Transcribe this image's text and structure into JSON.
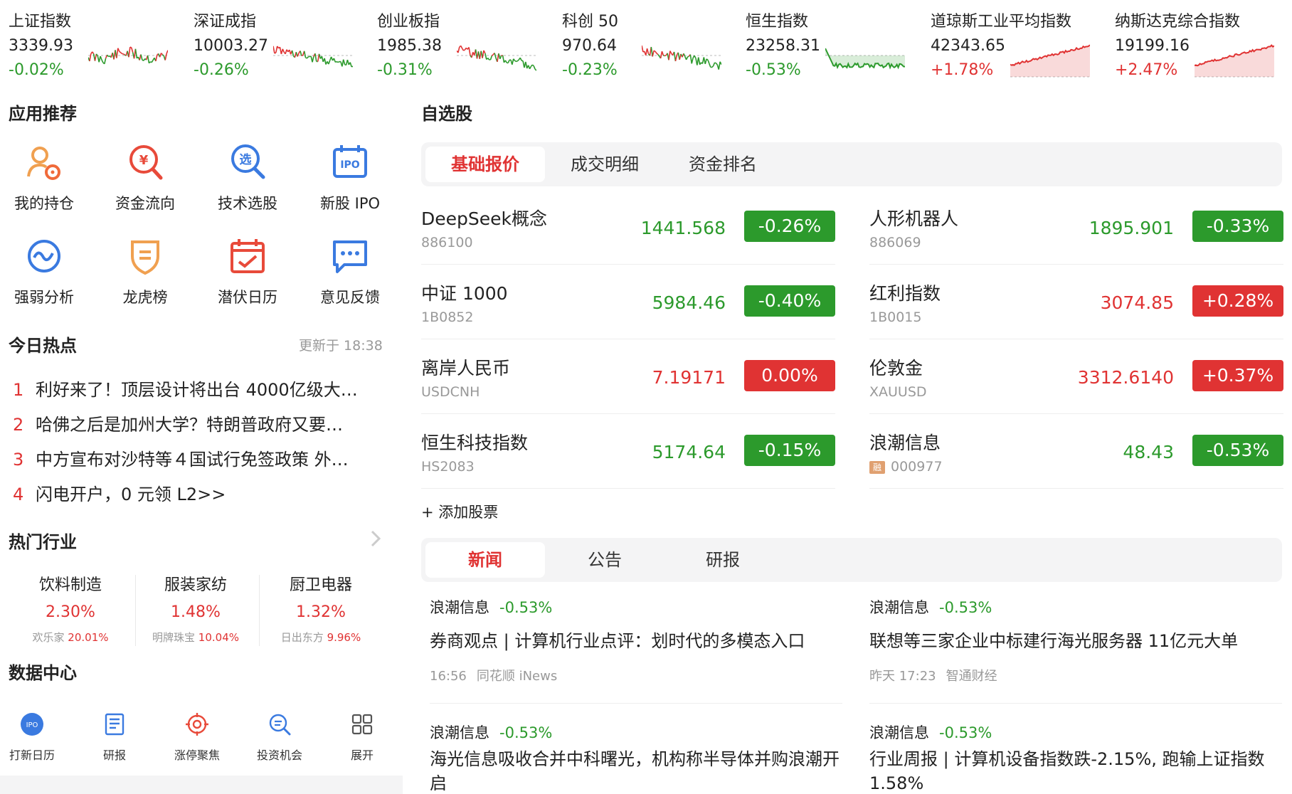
{
  "indices": [
    {
      "name": "上证指数",
      "price": "3339.93",
      "pct": "-0.02%",
      "dir": "down",
      "chart": "mixed"
    },
    {
      "name": "深证成指",
      "price": "10003.27",
      "pct": "-0.26%",
      "dir": "down",
      "chart": "mixed-down"
    },
    {
      "name": "创业板指",
      "price": "1985.38",
      "pct": "-0.31%",
      "dir": "down",
      "chart": "mixed-down"
    },
    {
      "name": "科创 50",
      "price": "970.64",
      "pct": "-0.23%",
      "dir": "down",
      "chart": "mixed-down"
    },
    {
      "name": "恒生指数",
      "price": "23258.31",
      "pct": "-0.53%",
      "dir": "down",
      "chart": "down-area"
    },
    {
      "name": "道琼斯工业平均指数",
      "price": "42343.65",
      "pct": "+1.78%",
      "dir": "up",
      "chart": "up-area"
    },
    {
      "name": "纳斯达克综合指数",
      "price": "19199.16",
      "pct": "+2.47%",
      "dir": "up",
      "chart": "up-area"
    }
  ],
  "apps": {
    "title": "应用推荐",
    "items": [
      {
        "label": "我的持仓",
        "icon": "holdings-icon"
      },
      {
        "label": "资金流向",
        "icon": "money-flow-icon"
      },
      {
        "label": "技术选股",
        "icon": "stock-picker-icon"
      },
      {
        "label": "新股 IPO",
        "icon": "ipo-icon"
      },
      {
        "label": "强弱分析",
        "icon": "strength-icon"
      },
      {
        "label": "龙虎榜",
        "icon": "dragon-tiger-icon"
      },
      {
        "label": "潜伏日历",
        "icon": "calendar-icon"
      },
      {
        "label": "意见反馈",
        "icon": "feedback-icon"
      }
    ]
  },
  "hot": {
    "title": "今日热点",
    "updated": "更新于 18:38",
    "items": [
      {
        "num": "1",
        "text": "利好来了！顶层设计将出台 4000亿级大…"
      },
      {
        "num": "2",
        "text": "哈佛之后是加州大学？特朗普政府又要…"
      },
      {
        "num": "3",
        "text": "中方宣布对沙特等４国试行免签政策 外…"
      },
      {
        "num": "4",
        "text": "闪电开户，0 元领 L2>>"
      }
    ]
  },
  "industry": {
    "title": "热门行业",
    "items": [
      {
        "name": "饮料制造",
        "pct": "2.30%",
        "stock": "欢乐家",
        "stock_pct": "20.01%"
      },
      {
        "name": "服装家纺",
        "pct": "1.48%",
        "stock": "明牌珠宝",
        "stock_pct": "10.04%"
      },
      {
        "name": "厨卫电器",
        "pct": "1.32%",
        "stock": "日出东方",
        "stock_pct": "9.96%"
      }
    ]
  },
  "datacenter": {
    "title": "数据中心",
    "items": [
      {
        "label": "打新日历",
        "icon": "ipo-calendar-icon"
      },
      {
        "label": "研报",
        "icon": "report-icon"
      },
      {
        "label": "涨停聚焦",
        "icon": "target-icon"
      },
      {
        "label": "投资机会",
        "icon": "search-opportunity-icon"
      },
      {
        "label": "展开",
        "icon": "grid-expand-icon"
      }
    ]
  },
  "watch": {
    "title": "自选股",
    "tabs": [
      "基础报价",
      "成交明细",
      "资金排名"
    ],
    "items": [
      {
        "name": "DeepSeek概念",
        "code": "886100",
        "price": "1441.568",
        "pct": "-0.26%",
        "dir": "down"
      },
      {
        "name": "人形机器人",
        "code": "886069",
        "price": "1895.901",
        "pct": "-0.33%",
        "dir": "down"
      },
      {
        "name": "中证 1000",
        "code": "1B0852",
        "price": "5984.46",
        "pct": "-0.40%",
        "dir": "down"
      },
      {
        "name": "红利指数",
        "code": "1B0015",
        "price": "3074.85",
        "pct": "+0.28%",
        "dir": "up"
      },
      {
        "name": "离岸人民币",
        "code": "USDCNH",
        "price": "7.19171",
        "pct": "0.00%",
        "dir": "up"
      },
      {
        "name": "伦敦金",
        "code": "XAUUSD",
        "price": "3312.6140",
        "pct": "+0.37%",
        "dir": "up"
      },
      {
        "name": "恒生科技指数",
        "code": "HS2083",
        "price": "5174.64",
        "pct": "-0.15%",
        "dir": "down"
      },
      {
        "name": "浪潮信息",
        "code": "000977",
        "price": "48.43",
        "pct": "-0.53%",
        "dir": "down",
        "badge": "融"
      }
    ],
    "add": "+ 添加股票"
  },
  "news": {
    "tabs": [
      "新闻",
      "公告",
      "研报"
    ],
    "items": [
      {
        "stock": "浪潮信息",
        "pct": "-0.53%",
        "title": "券商观点 | 计算机行业点评：划时代的多模态入口",
        "time": "16:56",
        "source": "同花顺 iNews"
      },
      {
        "stock": "浪潮信息",
        "pct": "-0.53%",
        "title": "联想等三家企业中标建行海光服务器 11亿元大单",
        "time": "昨天 17:23",
        "source": "智通财经"
      },
      {
        "stock": "浪潮信息",
        "pct": "-0.53%",
        "title": "海光信息吸收合并中科曙光，机构称半导体并购浪潮开启",
        "time": "",
        "source": ""
      },
      {
        "stock": "浪潮信息",
        "pct": "-0.53%",
        "title": "行业周报 | 计算机设备指数跌-2.15%, 跑输上证指数 1.58%",
        "time": "",
        "source": ""
      }
    ]
  },
  "colors": {
    "red": "#e03333",
    "green": "#2c9a2c"
  }
}
